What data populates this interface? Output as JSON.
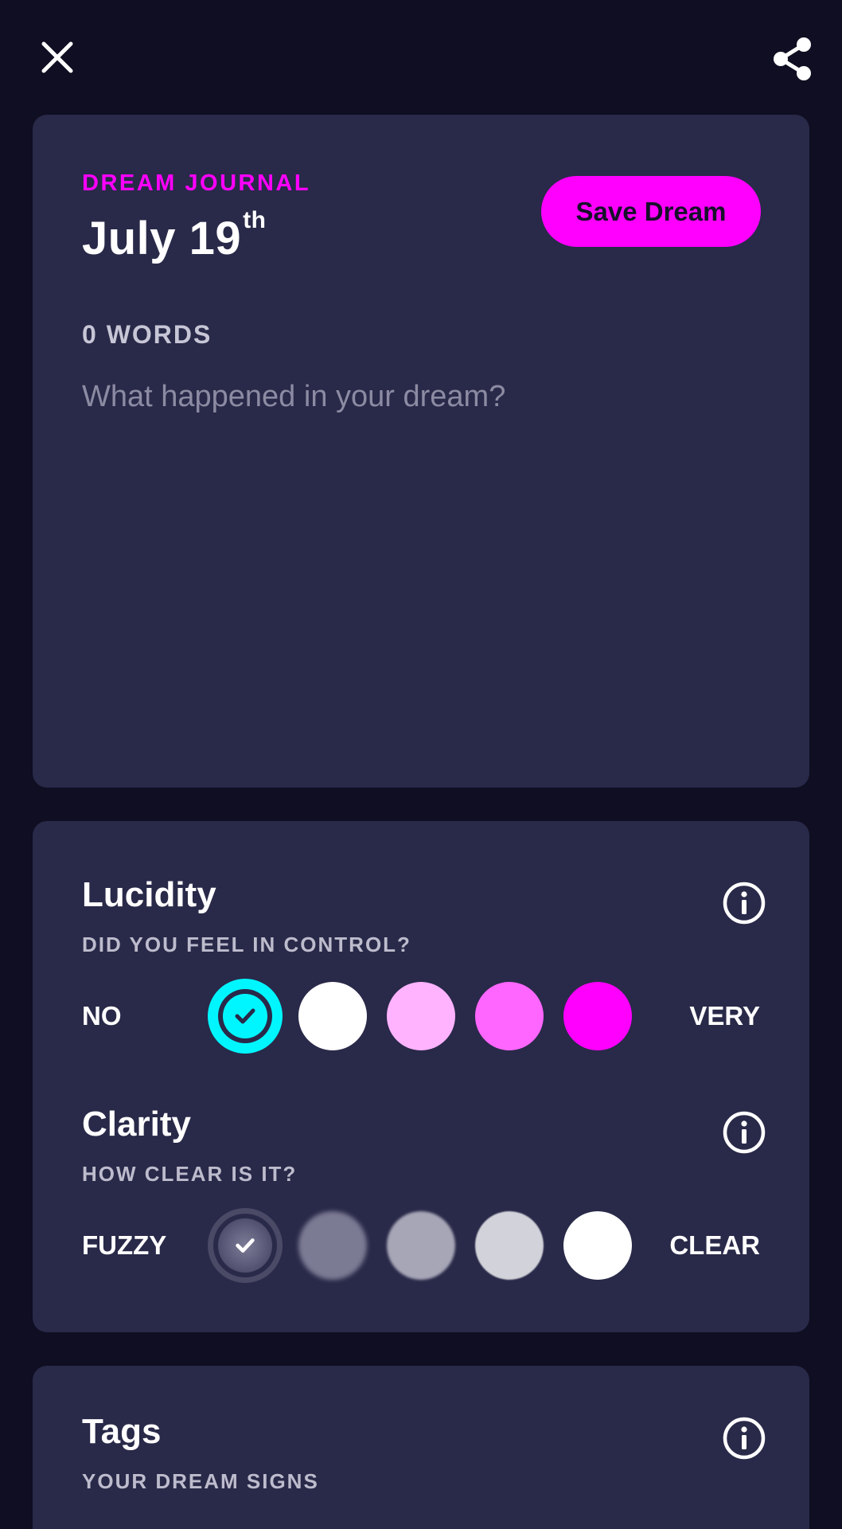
{
  "icons": {
    "close": "close-icon",
    "share": "share-icon",
    "info": "info-icon",
    "check": "check-icon"
  },
  "colors": {
    "background": "#0f0e22",
    "card": "#292949",
    "accent": "#ff00ff",
    "selected": "#00f6ff"
  },
  "journal": {
    "eyebrow": "DREAM JOURNAL",
    "date_main": "July 19",
    "date_suffix": "th",
    "save_label": "Save Dream",
    "word_count": "0 WORDS",
    "placeholder": "What happened in your dream?",
    "value": ""
  },
  "lucidity": {
    "title": "Lucidity",
    "subtitle": "DID YOU FEEL IN CONTROL?",
    "low_label": "NO",
    "high_label": "VERY",
    "selected_level": 1,
    "level_colors": [
      "#00f6ff",
      "#ffffff",
      "#ffb3ff",
      "#ff66ff",
      "#ff00ff"
    ]
  },
  "clarity": {
    "title": "Clarity",
    "subtitle": "HOW CLEAR IS IT?",
    "low_label": "FUZZY",
    "high_label": "CLEAR",
    "selected_level": 1,
    "level_colors": [
      "#5a5978",
      "#7c7b94",
      "#a7a6b7",
      "#d2d2da",
      "#ffffff"
    ]
  },
  "tags": {
    "title": "Tags",
    "subtitle": "YOUR DREAM SIGNS"
  }
}
